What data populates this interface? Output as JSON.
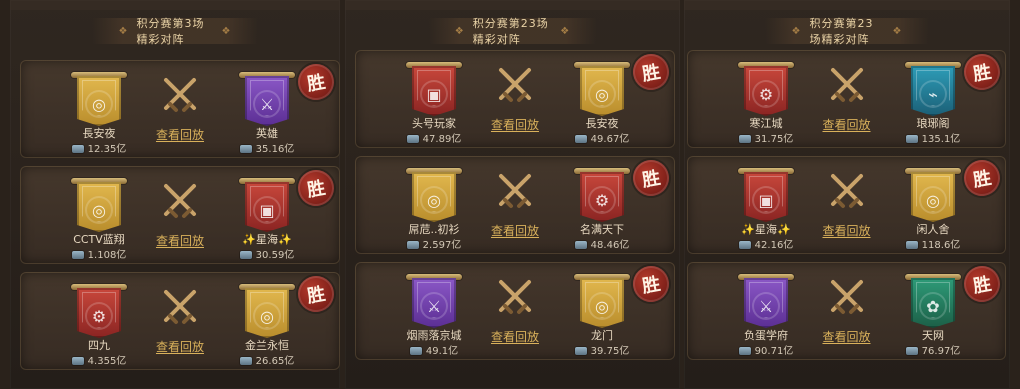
{
  "colors": {
    "bg": "#2a221b",
    "gold_text": "#d9b15b",
    "win_badge": "#b33a2c"
  },
  "ui": {
    "replay_label": "查看回放",
    "win_label": "胜"
  },
  "panels": [
    {
      "title": "积分赛第3场精彩对阵",
      "matches": [
        {
          "left": {
            "name": "長安夜",
            "score": "12.35亿",
            "banner": "gold",
            "emblem": "coin-icon"
          },
          "right": {
            "name": "英雄",
            "score": "35.16亿",
            "banner": "purple",
            "emblem": "sword-icon"
          },
          "winner": "right"
        },
        {
          "left": {
            "name": "CCTV蓝翔",
            "score": "1.108亿",
            "banner": "gold",
            "emblem": "coin-icon"
          },
          "right": {
            "name": "✨星海✨",
            "score": "30.59亿",
            "banner": "red-flag",
            "emblem": "shield-icon"
          },
          "winner": "right"
        },
        {
          "left": {
            "name": "四九",
            "score": "4.355亿",
            "banner": "red",
            "emblem": "gear-icon"
          },
          "right": {
            "name": "金兰永恒",
            "score": "26.65亿",
            "banner": "gold",
            "emblem": "coin-icon"
          },
          "winner": "right"
        }
      ]
    },
    {
      "title": "积分赛第23场精彩对阵",
      "matches": [
        {
          "left": {
            "name": "头号玩家",
            "score": "47.89亿",
            "banner": "red-flag",
            "emblem": "shield-icon"
          },
          "right": {
            "name": "長安夜",
            "score": "49.67亿",
            "banner": "gold",
            "emblem": "coin-icon"
          },
          "winner": "right"
        },
        {
          "left": {
            "name": "屌苊..初衫",
            "score": "2.597亿",
            "banner": "gold",
            "emblem": "coin-icon"
          },
          "right": {
            "name": "名满天下",
            "score": "48.46亿",
            "banner": "red",
            "emblem": "gear-icon"
          },
          "winner": "right"
        },
        {
          "left": {
            "name": "烟雨落京城",
            "score": "49.1亿",
            "banner": "purple",
            "emblem": "sword-icon"
          },
          "right": {
            "name": "龙门",
            "score": "39.75亿",
            "banner": "gold",
            "emblem": "coin-icon"
          },
          "winner": "right"
        }
      ]
    },
    {
      "title": "积分赛第23场精彩对阵",
      "matches": [
        {
          "left": {
            "name": "寒江城",
            "score": "31.75亿",
            "banner": "red",
            "emblem": "gear-icon"
          },
          "right": {
            "name": "琅琊阁",
            "score": "135.1亿",
            "banner": "blue",
            "emblem": "fan-icon"
          },
          "winner": "right"
        },
        {
          "left": {
            "name": "✨星海✨",
            "score": "42.16亿",
            "banner": "red-flag",
            "emblem": "shield-icon"
          },
          "right": {
            "name": "闲人舍",
            "score": "118.6亿",
            "banner": "gold",
            "emblem": "coin-icon"
          },
          "winner": "right"
        },
        {
          "left": {
            "name": "负蛋学府",
            "score": "90.71亿",
            "banner": "purple",
            "emblem": "sword-icon"
          },
          "right": {
            "name": "天网",
            "score": "76.97亿",
            "banner": "green",
            "emblem": "flower-icon"
          },
          "winner": "right"
        }
      ]
    }
  ]
}
